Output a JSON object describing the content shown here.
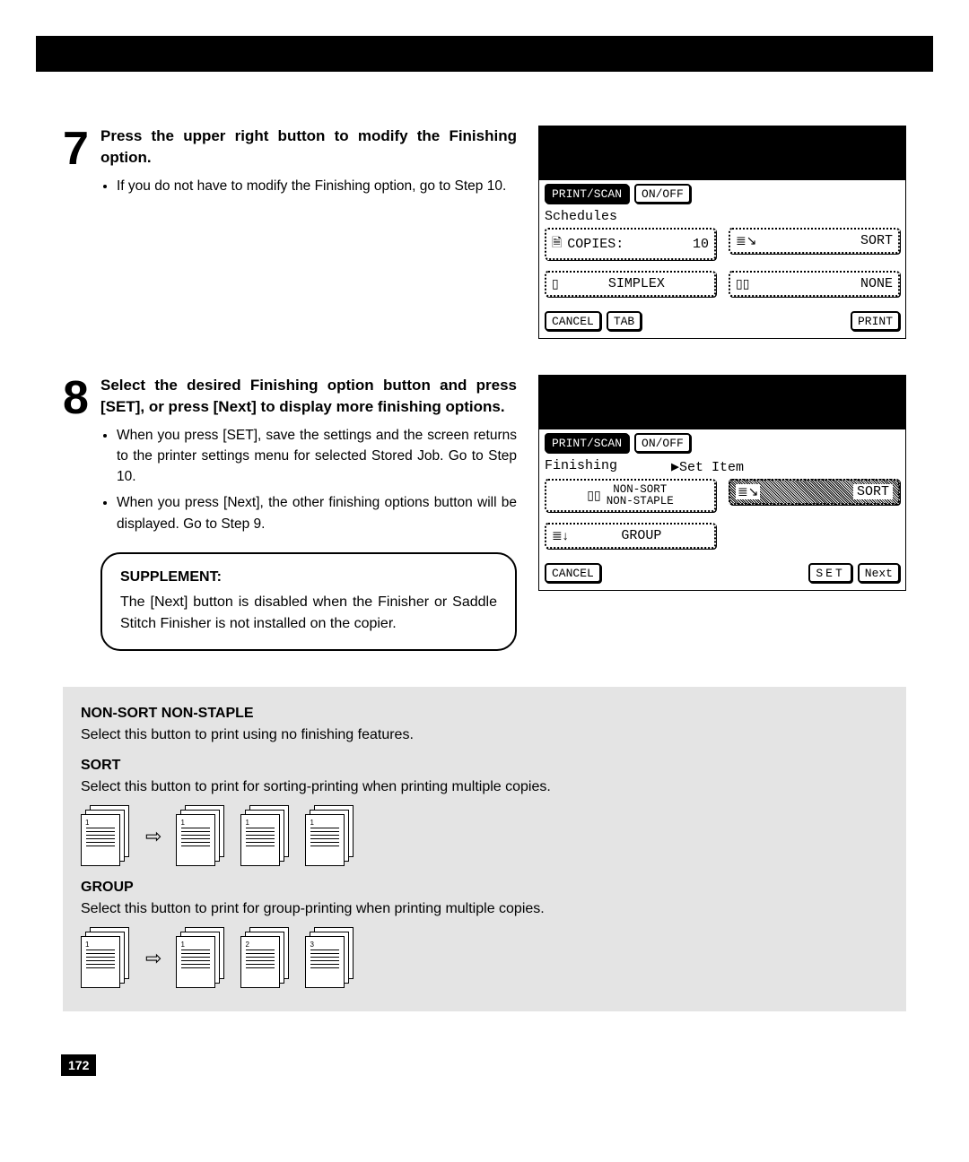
{
  "step7": {
    "number": "7",
    "title": "Press the upper right button to modify the Finishing option.",
    "bullets": [
      "If you do not have to modify the Finishing option, go to Step 10."
    ]
  },
  "step8": {
    "number": "8",
    "title": "Select the desired Finishing option button and press [SET], or press [Next] to display more finishing options.",
    "bullets": [
      "When you press [SET], save the settings and the screen returns to the printer settings menu for selected Stored Job.  Go to Step 10.",
      "When you press [Next], the other finishing options button will be displayed.  Go to Step 9."
    ],
    "supplement_title": "SUPPLEMENT:",
    "supplement_body": "The [Next] button is disabled when the Finisher or Saddle Stitch Finisher is not installed on the copier."
  },
  "lcd1": {
    "print_scan": "PRINT/SCAN",
    "onoff": "ON/OFF",
    "subhead": "Schedules",
    "copies_label": "COPIES:",
    "copies_value": "10",
    "sort": "SORT",
    "simplex": "SIMPLEX",
    "none": "NONE",
    "cancel": "CANCEL",
    "tab": "TAB",
    "print": "PRINT"
  },
  "lcd2": {
    "print_scan": "PRINT/SCAN",
    "onoff": "ON/OFF",
    "subhead_left": "Finishing",
    "subhead_right": "▶Set Item",
    "nonsort_line1": "NON-SORT",
    "nonsort_line2": "NON-STAPLE",
    "sort": "SORT",
    "group": "GROUP",
    "cancel": "CANCEL",
    "set": "SET",
    "next": "Next"
  },
  "greybox": {
    "nonsort_h": "NON-SORT NON-STAPLE",
    "nonsort_b": "Select this button to print using no finishing features.",
    "sort_h": "SORT",
    "sort_b": "Select this button to print for sorting-printing when printing multiple copies.",
    "group_h": "GROUP",
    "group_b": "Select this button to print for group-printing when printing multiple copies."
  },
  "page_number": "172"
}
